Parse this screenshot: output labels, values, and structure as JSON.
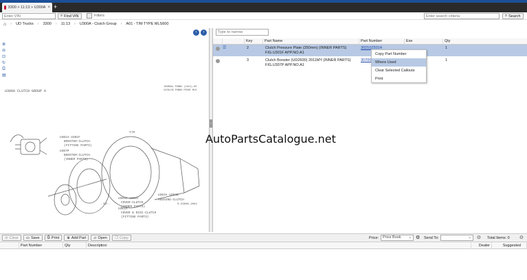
{
  "tab": {
    "title": "3300 > 11:13 > U300A",
    "new_tab": "+"
  },
  "search": {
    "vin_placeholder": "Enter VIN",
    "find_vin": "Find VIN",
    "filters": "Filters",
    "criteria_placeholder": "Enter search criteria",
    "search_button": "Search"
  },
  "breadcrumb": [
    "UD Trucks",
    "3300",
    "11:13",
    "U300A - Clutch Group",
    "A01 - T/M TYPE MLS600"
  ],
  "narrow": {
    "placeholder": "Type to narrow"
  },
  "table": {
    "columns": [
      "",
      "Key",
      "Part Name",
      "Part Number",
      "Exe",
      "Qty"
    ],
    "rows": [
      {
        "key": "2",
        "name1": "Clutch Pressure Plate (350mm) (INNER PARTS)",
        "name2": "FIG.U301F APP.NO.A1",
        "part": "30210Z5014",
        "exe": "",
        "qty": "1"
      },
      {
        "key": "3",
        "name1": "Clutch Booster (UD2600) 2011MY (INNER PARTS)",
        "name2": "FIG.U307P APP.NO.A1",
        "part": "30700Z5028",
        "exe": "",
        "qty": "1"
      }
    ]
  },
  "context_menu": [
    "Copy Part Number",
    "Where Used",
    "Clear Selected Callouts",
    "Print"
  ],
  "drawing": {
    "group_label": "U300A  CLUTCH GROUP    A",
    "note1": "JOURNAL  PUBNO   (1913)-00",
    "note2": "CATALOG  PUBNO  FRONT  MLR",
    "c1": "U301A  U301F",
    "c1b": "BOOSTER-CLUTCH",
    "c1c": "(FITTING PARTS)",
    "c2": "U307P",
    "c2b": "BOOSTER-CLUTCH",
    "c2c": "(INNER PARTS)",
    "c3": "U304A  U304B",
    "c3b": "HOUSING-CLUTCH",
    "c4": "U301A",
    "c4b": "COVER & DISC-CLUTCH",
    "c4c": "(FITTING PARTS)",
    "c5": "U301F  U301C",
    "c5b": "COVER-CLUTCH",
    "c5c": "(INNER PARTS)",
    "tm": "T/M",
    "ref": "S-U300A-2004",
    "small": "- SIE -"
  },
  "watermark": "AutoPartsCatalogue.net",
  "bottom_toolbar": {
    "clear": "Clear",
    "save": "Save",
    "print": "Print",
    "add_part": "Add Part",
    "open": "Open",
    "copy": "Copy",
    "price_label": "Price:",
    "price_value": "Price Book",
    "send_to_label": "Send To:",
    "total_items": "Total Items: 0"
  },
  "bottom_columns": [
    "",
    "Part Number",
    "Qty",
    "Description",
    "Dealer",
    "Suggested"
  ]
}
